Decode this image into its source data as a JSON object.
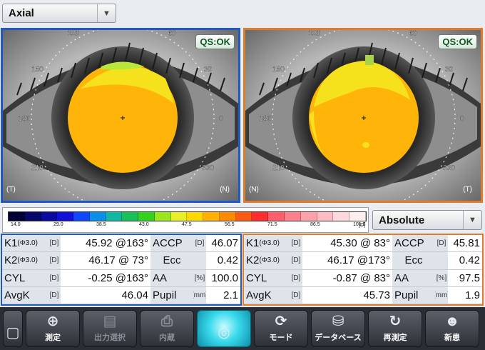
{
  "map_select": {
    "value": "Axial"
  },
  "scale_select": {
    "value": "Absolute"
  },
  "right_eye": {
    "status": "QS:OK",
    "side_left": "(T)",
    "side_right": "(N)",
    "measurements": {
      "k1": {
        "label": "K1",
        "sub": "(Φ3.0)",
        "unit": "[D]",
        "value": "45.92 @163°"
      },
      "k2": {
        "label": "K2",
        "sub": "(Φ3.0)",
        "unit": "[D]",
        "value": "46.17 @  73°"
      },
      "cyl": {
        "label": "CYL",
        "unit": "[D]",
        "value": "-0.25 @163°"
      },
      "avgk": {
        "label": "AvgK",
        "unit": "[D]",
        "value": "46.04"
      },
      "accp": {
        "label": "ACCP",
        "unit": "[D]",
        "value": "46.07"
      },
      "ecc": {
        "label": "Ecc",
        "unit": "",
        "value": "0.42"
      },
      "aa": {
        "label": "AA",
        "unit": "[%]",
        "value": "100.0"
      },
      "pupil": {
        "label": "Pupil",
        "unit": "[mm]",
        "value": "2.1"
      }
    }
  },
  "left_eye": {
    "status": "QS:OK",
    "side_left": "(N)",
    "side_right": "(T)",
    "measurements": {
      "k1": {
        "label": "K1",
        "sub": "(Φ3.0)",
        "unit": "[D]",
        "value": "45.30 @  83°"
      },
      "k2": {
        "label": "K2",
        "sub": "(Φ3.0)",
        "unit": "[D]",
        "value": "46.17 @173°"
      },
      "cyl": {
        "label": "CYL",
        "unit": "[D]",
        "value": "-0.87 @  83°"
      },
      "avgk": {
        "label": "AvgK",
        "unit": "[D]",
        "value": "45.73"
      },
      "accp": {
        "label": "ACCP",
        "unit": "[D]",
        "value": "45.81"
      },
      "ecc": {
        "label": "Ecc",
        "unit": "",
        "value": "0.42"
      },
      "aa": {
        "label": "AA",
        "unit": "[%]",
        "value": "97.5"
      },
      "pupil": {
        "label": "Pupil",
        "unit": "[mm]",
        "value": "1.9"
      }
    }
  },
  "degree_labels": [
    "90",
    "60",
    "30",
    "0",
    "330",
    "300",
    "270",
    "240",
    "210",
    "180",
    "150",
    "120"
  ],
  "color_scale": {
    "ticks": [
      "14.0",
      "29.0",
      "38.5",
      "43.0",
      "47.5",
      "56.5",
      "71.5",
      "86.5",
      "101.5"
    ],
    "unit": "[D]",
    "colors": [
      "#000035",
      "#06066b",
      "#0a0aa3",
      "#1010d8",
      "#0f47ff",
      "#0b8fe8",
      "#10b9a1",
      "#17c15a",
      "#33d21c",
      "#9be61a",
      "#e8f025",
      "#ffd800",
      "#ffb000",
      "#ff8a00",
      "#ff5a14",
      "#ff2d2d",
      "#ff5e6a",
      "#ff808d",
      "#ffa0ab",
      "#ffbcc4",
      "#ffd8dd",
      "#ffeef0"
    ]
  },
  "map_colors": {
    "main": "#ffb40a",
    "mid": "#f6e21c",
    "high": "#b9e63a",
    "edge": "#a8d24a"
  },
  "toolbar": [
    {
      "id": "partial",
      "label": "",
      "icon": "▢",
      "state": "normal"
    },
    {
      "id": "measure",
      "label": "測定",
      "icon": "⊕",
      "state": "normal"
    },
    {
      "id": "output",
      "label": "出力選択",
      "icon": "▤",
      "state": "dim"
    },
    {
      "id": "print",
      "label": "内蔵",
      "icon": "⎙",
      "state": "dim"
    },
    {
      "id": "current",
      "label": "",
      "icon": "◎",
      "state": "active"
    },
    {
      "id": "mode",
      "label": "モード",
      "icon": "⟳",
      "state": "normal"
    },
    {
      "id": "database",
      "label": "データベース",
      "icon": "⛁",
      "state": "normal"
    },
    {
      "id": "remeasure",
      "label": "再測定",
      "icon": "↻",
      "state": "normal"
    },
    {
      "id": "new",
      "label": "新患",
      "icon": "☻",
      "state": "normal"
    }
  ]
}
